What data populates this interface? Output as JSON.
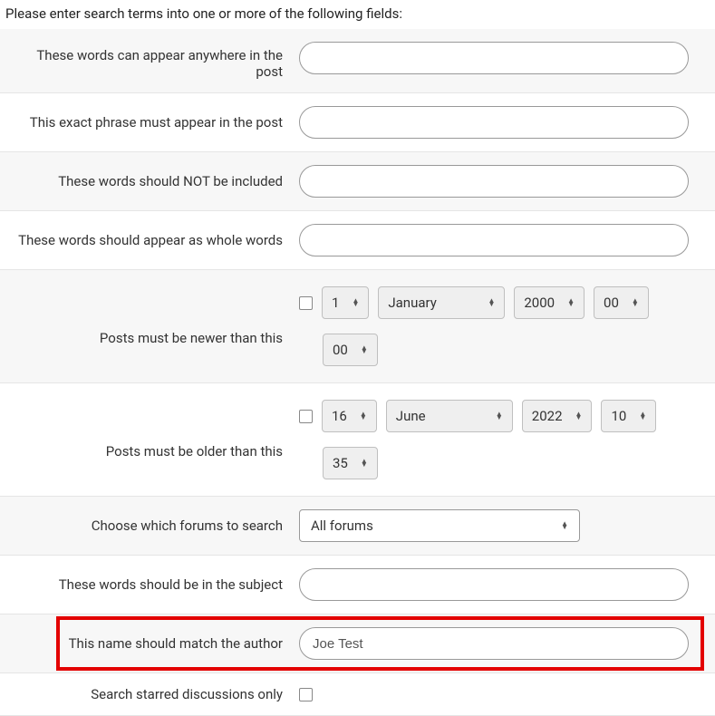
{
  "intro": "Please enter search terms into one or more of the following fields:",
  "fields": {
    "anywhere_label": "These words can appear anywhere in the post",
    "anywhere_value": "",
    "exact_label": "This exact phrase must appear in the post",
    "exact_value": "",
    "not_label": "These words should NOT be included",
    "not_value": "",
    "whole_label": "These words should appear as whole words",
    "whole_value": "",
    "newer_label": "Posts must be newer than this",
    "newer": {
      "day": "1",
      "month": "January",
      "year": "2000",
      "hour": "00",
      "minute": "00"
    },
    "older_label": "Posts must be older than this",
    "older": {
      "day": "16",
      "month": "June",
      "year": "2022",
      "hour": "10",
      "minute": "35"
    },
    "forums_label": "Choose which forums to search",
    "forums_value": "All forums",
    "subject_label": "These words should be in the subject",
    "subject_value": "",
    "author_label": "This name should match the author",
    "author_value": "Joe Test",
    "starred_label": "Search starred discussions only"
  }
}
